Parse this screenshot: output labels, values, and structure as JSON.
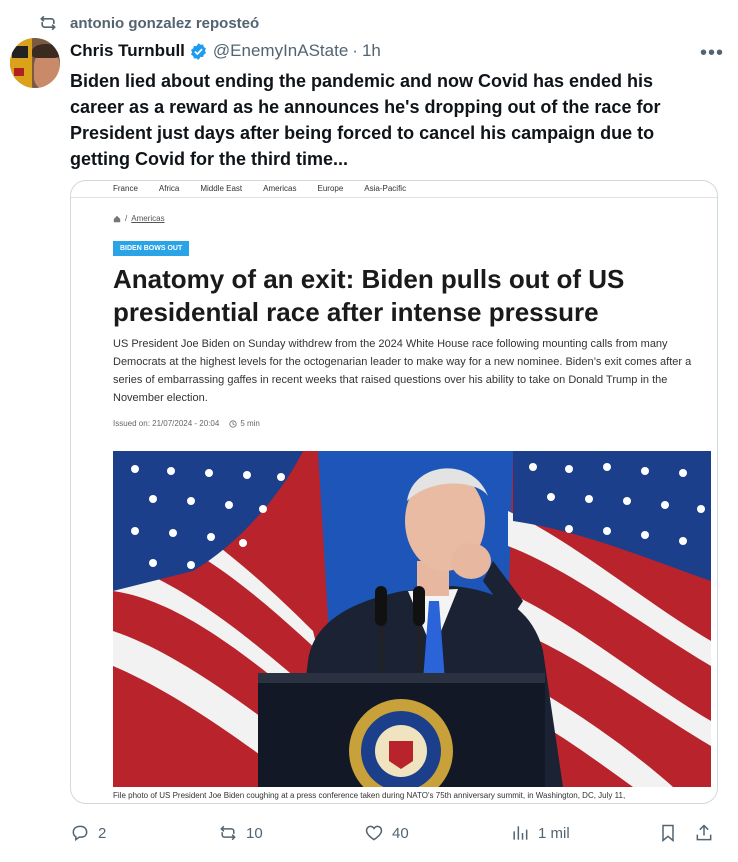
{
  "repost": {
    "label": "antonio gonzalez reposteó"
  },
  "tweet": {
    "author_name": "Chris Turnbull",
    "handle": "@EnemyInAState",
    "separator": "·",
    "time": "1h",
    "text": "Biden lied about ending the pandemic and now Covid has ended his career as a reward as he announces he's dropping out of the race for President just days after being forced to cancel his campaign due to getting Covid for the third time..."
  },
  "article": {
    "nav": [
      "France",
      "Africa",
      "Middle East",
      "Americas",
      "Europe",
      "Asia-Pacific"
    ],
    "breadcrumb_sep": "/",
    "breadcrumb": "Americas",
    "tag": "BIDEN BOWS OUT",
    "headline": "Anatomy of an exit: Biden pulls out of US presidential race after intense pressure",
    "lede": "US President Joe Biden on Sunday withdrew from the 2024 White House race following mounting calls from many Democrats at the highest levels for the octogenarian leader to make way for a new nominee. Biden’s exit comes after a series of embarrassing gaffes in recent weeks that raised questions over his ability to take on Donald Trump in the November election.",
    "issued": "Issued on: 21/07/2024 - 20:04",
    "read_time": "5 min",
    "caption": "File photo of US President Joe Biden coughing at a press conference taken during NATO's 75th anniversary summit, in Washington, DC, July 11,"
  },
  "actions": {
    "replies": "2",
    "reposts": "10",
    "likes": "40",
    "views": "1 mil"
  },
  "colors": {
    "verified": "#1d9bf0",
    "muted": "#536471",
    "tag": "#2aa4e6"
  },
  "icons": [
    "repost-icon",
    "verified-badge-icon",
    "more-icon",
    "home-icon",
    "clock-icon",
    "reply-icon",
    "like-icon",
    "views-icon",
    "bookmark-icon",
    "share-icon"
  ]
}
